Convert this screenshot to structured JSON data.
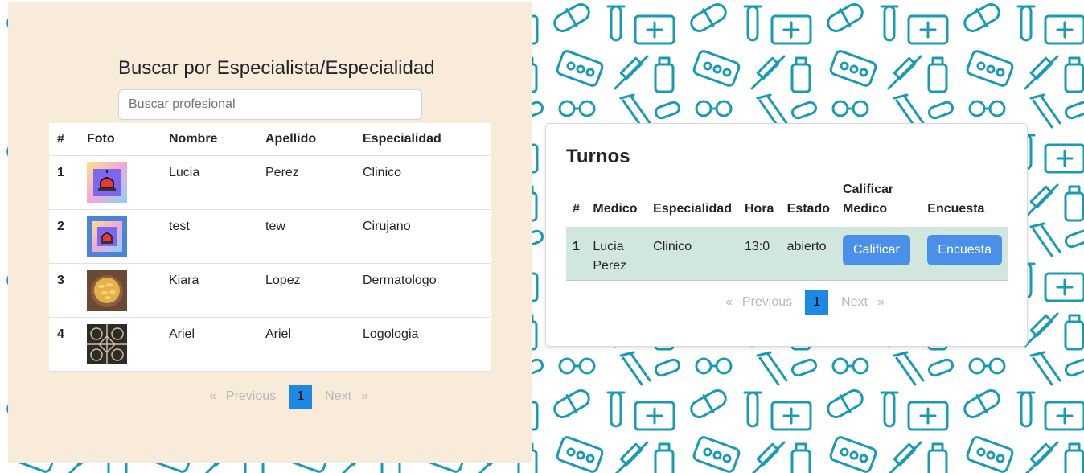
{
  "colors": {
    "panel_bg": "#f9ebda",
    "pattern": "#1a9bb5",
    "accent": "#1e88e5",
    "button": "#4a90e8",
    "row_highlight": "#d1e7dd"
  },
  "search": {
    "title": "Buscar por Especialista/Especialidad",
    "placeholder": "Buscar profesional",
    "value": ""
  },
  "specialists_table": {
    "headers": [
      "#",
      "Foto",
      "Nombre",
      "Apellido",
      "Especialidad"
    ],
    "rows": [
      {
        "num": "1",
        "photo_icon": "siren-icon",
        "nombre": "Lucia",
        "apellido": "Perez",
        "especialidad": "Clinico"
      },
      {
        "num": "2",
        "photo_icon": "siren-icon",
        "nombre": "test",
        "apellido": "tew",
        "especialidad": "Cirujano"
      },
      {
        "num": "3",
        "photo_icon": "food-photo",
        "nombre": "Kiara",
        "apellido": "Lopez",
        "especialidad": "Dermatologo"
      },
      {
        "num": "4",
        "photo_icon": "pattern-photo",
        "nombre": "Ariel",
        "apellido": "Ariel",
        "especialidad": "Logologia"
      }
    ]
  },
  "pagination_left": {
    "prev_arrow": "«",
    "prev": "Previous",
    "current": "1",
    "next": "Next",
    "next_arrow": "»"
  },
  "turnos": {
    "title": "Turnos",
    "headers": {
      "num": "#",
      "medico": "Medico",
      "especialidad": "Especialidad",
      "hora": "Hora",
      "estado": "Estado",
      "calificar_line1": "Calificar",
      "calificar_line2": "Medico",
      "encuesta": "Encuesta"
    },
    "rows": [
      {
        "num": "1",
        "medico_line1": "Lucia",
        "medico_line2": "Perez",
        "especialidad": "Clinico",
        "hora": "13:0",
        "estado": "abierto",
        "calificar_button": "Calificar",
        "encuesta_button": "Encuesta"
      }
    ]
  },
  "pagination_right": {
    "prev_arrow": "«",
    "prev": "Previous",
    "current": "1",
    "next": "Next",
    "next_arrow": "»"
  }
}
